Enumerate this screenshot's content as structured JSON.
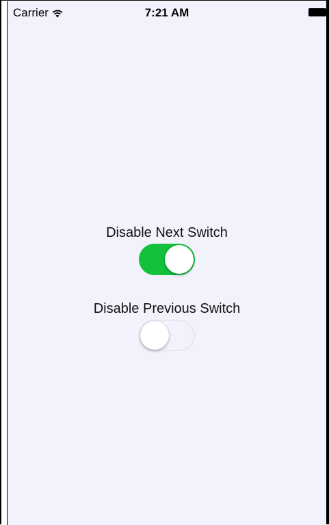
{
  "status_bar": {
    "carrier": "Carrier",
    "wifi_icon": "wifi-icon",
    "time": "7:21 AM",
    "battery_icon": "battery-icon"
  },
  "controls": [
    {
      "label": "Disable Next Switch",
      "is_on": true,
      "on_color": "#13c13b"
    },
    {
      "label": "Disable Previous Switch",
      "is_on": false
    }
  ],
  "colors": {
    "background": "#f2f2fc",
    "switch_on": "#13c13b"
  }
}
